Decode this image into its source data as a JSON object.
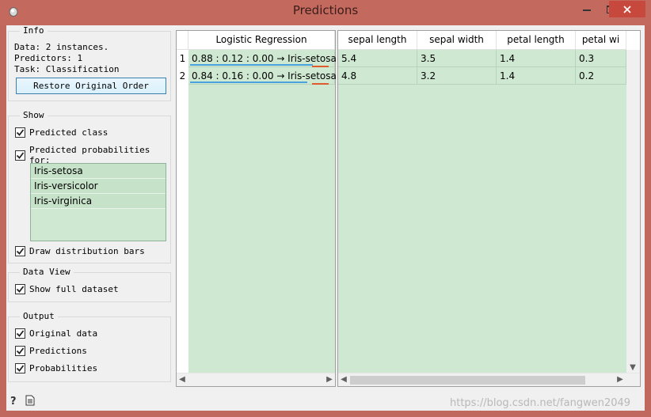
{
  "window": {
    "title": "Predictions"
  },
  "info": {
    "title": "Info",
    "lines": [
      "Data: 2 instances.",
      "Predictors: 1",
      "Task: Classification"
    ],
    "restore_button": "Restore Original Order"
  },
  "show": {
    "title": "Show",
    "predicted_class": "Predicted class",
    "predicted_probabilities": "Predicted probabilities for:",
    "classes": [
      "Iris-setosa",
      "Iris-versicolor",
      "Iris-virginica"
    ],
    "draw_bars": "Draw distribution bars"
  },
  "data_view": {
    "title": "Data View",
    "show_full": "Show full dataset"
  },
  "output": {
    "title": "Output",
    "original_data": "Original data",
    "predictions": "Predictions",
    "probabilities": "Probabilities"
  },
  "predictions_table": {
    "header": "Logistic Regression",
    "rows": [
      {
        "num": "1",
        "text": "0.88 : 0.12 : 0.00 → Iris-setosa",
        "prob": 0.88
      },
      {
        "num": "2",
        "text": "0.84 : 0.16 : 0.00 → Iris-setosa",
        "prob": 0.84
      }
    ]
  },
  "data_table": {
    "headers": [
      "sepal length",
      "sepal width",
      "petal length",
      "petal wi"
    ],
    "rows": [
      [
        "5.4",
        "3.5",
        "1.4",
        "0.3"
      ],
      [
        "4.8",
        "3.2",
        "1.4",
        "0.2"
      ]
    ]
  },
  "watermark": "https://blog.csdn.net/fangwen2049"
}
